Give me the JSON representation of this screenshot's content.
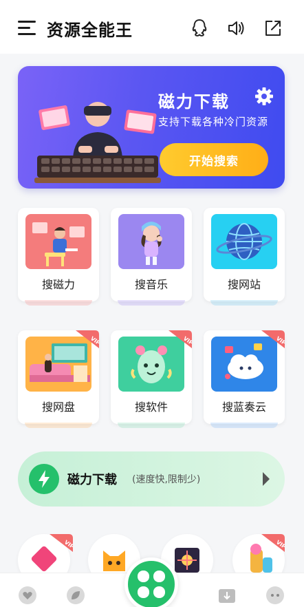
{
  "header": {
    "title": "资源全能王",
    "icons": [
      "menu-icon",
      "qq-icon",
      "speaker-icon",
      "share-icon"
    ]
  },
  "banner": {
    "title": "磁力下载",
    "subtitle": "支持下载各种冷门资源",
    "button_label": "开始搜索",
    "icon": "gear-icon",
    "colors": {
      "gradient_start": "#7a63f7",
      "gradient_end": "#3f4bf0",
      "button": "#ffbb22"
    }
  },
  "tools": [
    {
      "label": "搜磁力",
      "vip": false
    },
    {
      "label": "搜音乐",
      "vip": false
    },
    {
      "label": "搜网站",
      "vip": false
    },
    {
      "label": "搜网盘",
      "vip": true
    },
    {
      "label": "搜软件",
      "vip": true
    },
    {
      "label": "搜蓝奏云",
      "vip": true
    }
  ],
  "vip_badge": "VIP",
  "magnet_bar": {
    "title": "磁力下载",
    "subtitle": "(速度快,限制少)",
    "icon": "lightning-icon",
    "accent": "#25c06b"
  },
  "tabbar": {
    "icons": [
      "heart-icon",
      "leaf-icon",
      "clover-icon",
      "download-folder-icon",
      "robot-icon"
    ]
  }
}
